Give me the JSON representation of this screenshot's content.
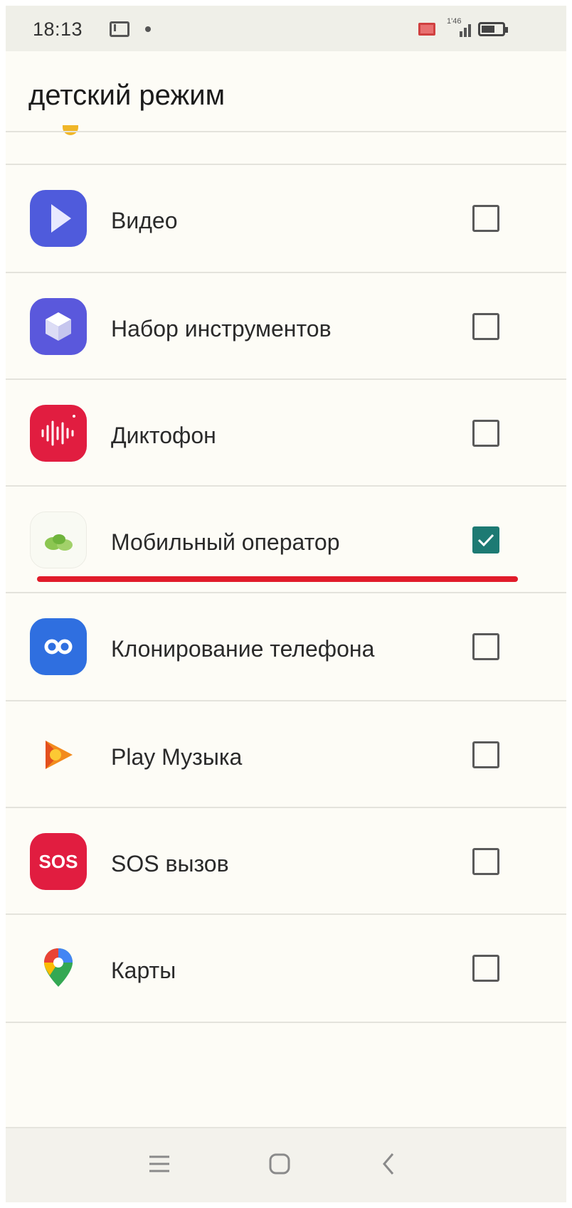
{
  "status_bar": {
    "time": "18:13",
    "network_label": "1'46",
    "icons": [
      "mail-icon",
      "notification-dot-icon",
      "screen-cast-icon",
      "signal-icon",
      "battery-icon"
    ]
  },
  "header": {
    "title": "детский режим"
  },
  "apps": [
    {
      "label": "Видео",
      "icon": "video-play-icon",
      "checked": false,
      "color": "#4a5ad8"
    },
    {
      "label": "Набор инструментов",
      "icon": "toolbox-cube-icon",
      "checked": false,
      "color": "#5556d8"
    },
    {
      "label": "Диктофон",
      "icon": "voice-recorder-icon",
      "checked": false,
      "color": "#e11d40"
    },
    {
      "label": "Мобильный оператор",
      "icon": "mobile-operator-icon",
      "checked": true,
      "color": "#7fc44a"
    },
    {
      "label": "Клонирование телефона",
      "icon": "phone-clone-icon",
      "checked": false,
      "color": "#2f6fe0"
    },
    {
      "label": "Play Музыка",
      "icon": "play-music-icon",
      "checked": false,
      "color": "#f28b1e"
    },
    {
      "label": "SOS вызов",
      "icon": "sos-icon",
      "checked": false,
      "color": "#e11d40"
    },
    {
      "label": "Карты",
      "icon": "maps-pin-icon",
      "checked": false,
      "color": "#ea4335"
    }
  ],
  "sos_icon_text": "SOS",
  "colors": {
    "accent_check": "#1d7a73",
    "highlight_underline": "#e11c2a"
  },
  "nav_bar": {
    "buttons": [
      "menu-icon",
      "home-icon",
      "back-icon"
    ]
  }
}
